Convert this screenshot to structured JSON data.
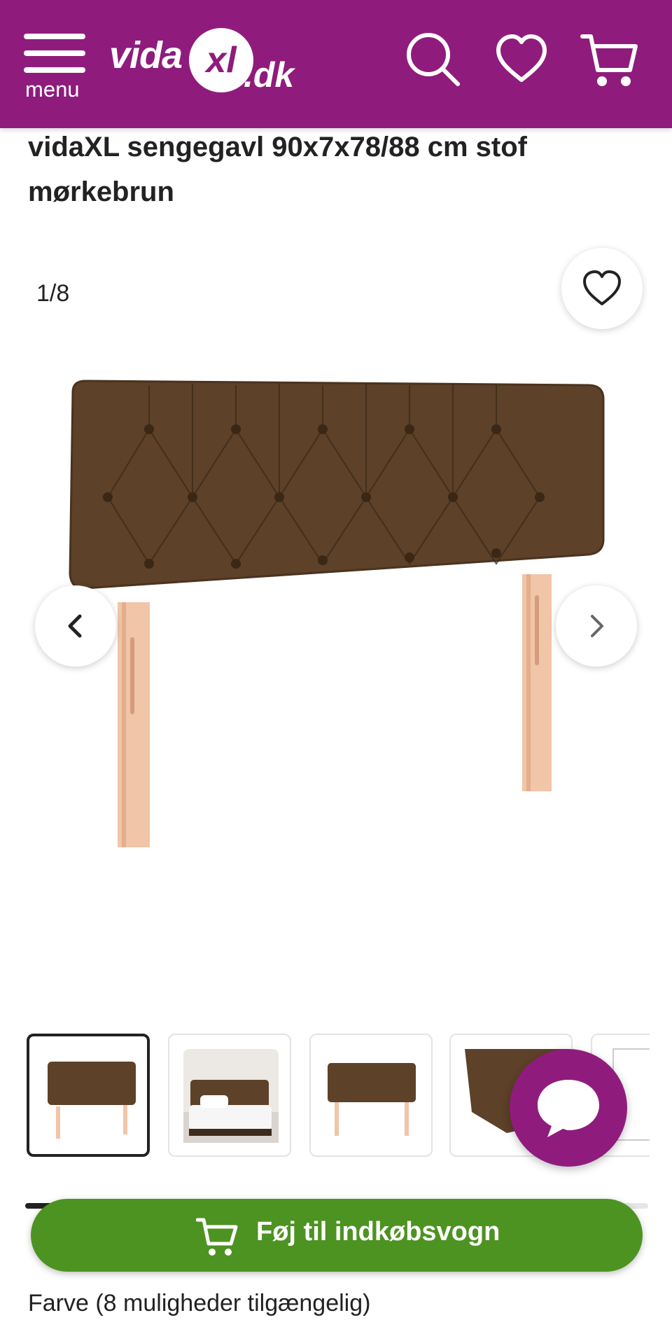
{
  "header": {
    "menu_label": "menu",
    "logo": {
      "vida": "vida",
      "xl": "xl",
      "dk": ".dk"
    },
    "background_color": "#8f1c7d",
    "icons": [
      "hamburger-menu-icon",
      "search-icon",
      "heart-icon",
      "cart-icon"
    ]
  },
  "product": {
    "title": "vidaXL sengegavl 90x7x78/88 cm stof mørkebrun"
  },
  "gallery": {
    "counter": "1/8",
    "current_index": 1,
    "total_images": 8,
    "visible_thumbnails": 5,
    "scroll_progress": 0.2
  },
  "actions": {
    "add_to_cart_label": "Føj til indkøbsvogn",
    "button_color": "#4d9321",
    "chat_color": "#8f1c7d"
  },
  "options": {
    "color_heading": "Farve (8 muligheder tilgængelig)"
  }
}
